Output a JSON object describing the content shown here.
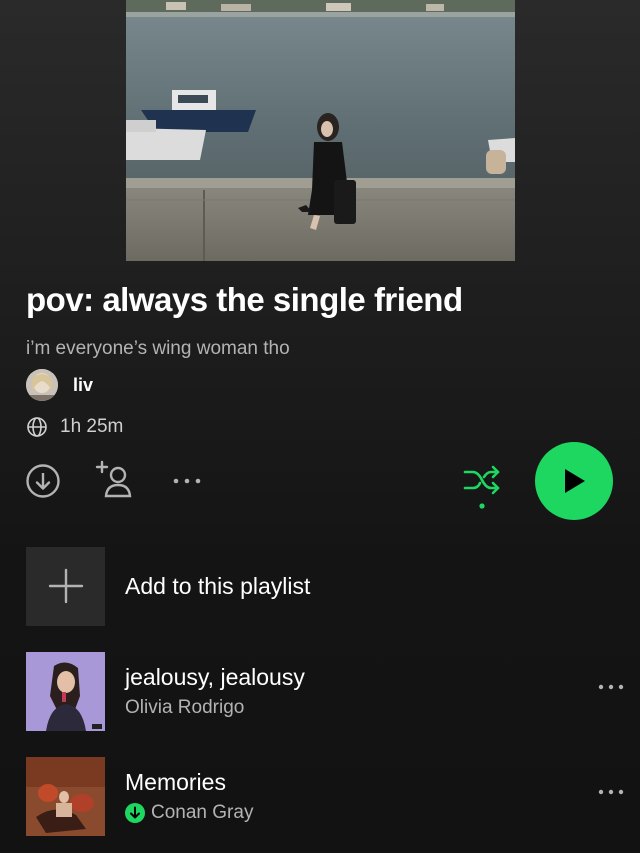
{
  "playlist": {
    "title": "pov: always the single friend",
    "description": "i’m everyone’s wing woman tho",
    "owner": "liv",
    "duration": "1h 25m"
  },
  "actions": {
    "download_icon": "download-circle-icon",
    "add_user_icon": "add-user-icon",
    "more_icon": "more-horizontal-icon",
    "shuffle_icon": "shuffle-icon",
    "play_icon": "play-icon"
  },
  "add_row": {
    "label": "Add to this playlist"
  },
  "tracks": [
    {
      "title": "jealousy, jealousy",
      "artist": "Olivia Rodrigo",
      "downloaded": false
    },
    {
      "title": "Memories",
      "artist": "Conan Gray",
      "downloaded": true
    }
  ],
  "colors": {
    "accent": "#1ed760",
    "background": "#121212",
    "secondary_text": "#b3b3b3"
  }
}
